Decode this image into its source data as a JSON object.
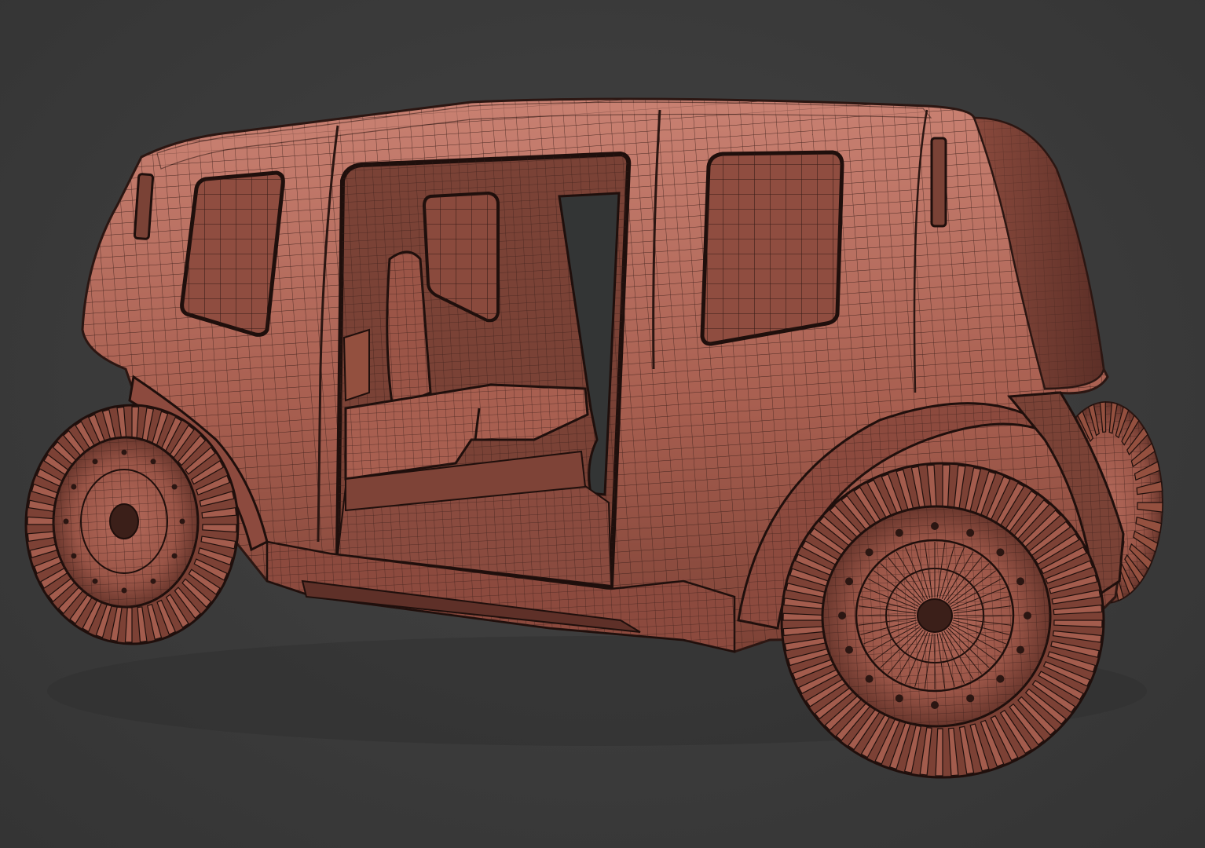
{
  "scene": {
    "subject_icon": "wireframe-vehicle-render",
    "colors": {
      "background": "#3b3b3b",
      "surface": "#a85f50",
      "surface_light": "#c07567",
      "surface_dark": "#6e3a30",
      "wire": "#3a1f1a",
      "window": "#8f4d40",
      "interior": "#7a4236",
      "floor": "#8a4b3f",
      "cavity": "#333535"
    }
  }
}
